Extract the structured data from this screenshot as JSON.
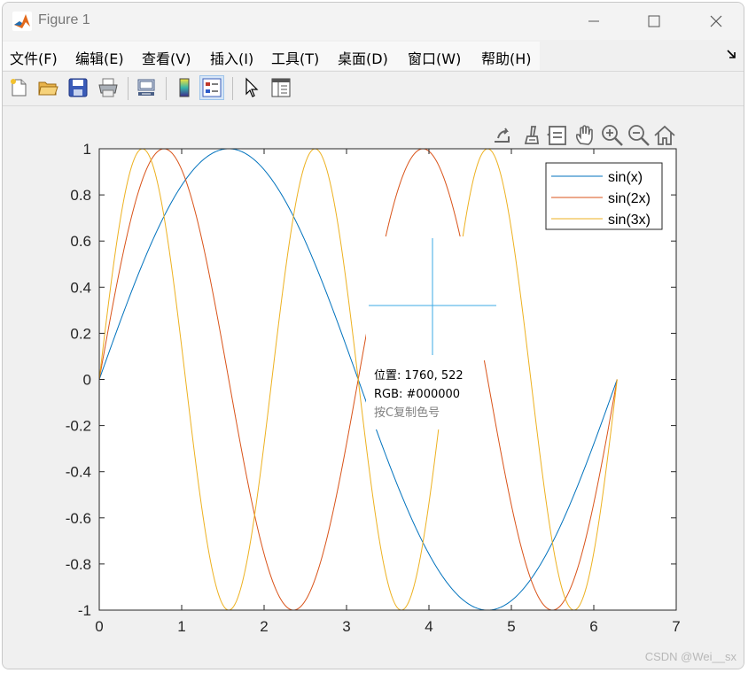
{
  "window": {
    "title": "Figure 1"
  },
  "menu": [
    {
      "label": "文件(F)"
    },
    {
      "label": "编辑(E)"
    },
    {
      "label": "查看(V)"
    },
    {
      "label": "插入(I)"
    },
    {
      "label": "工具(T)"
    },
    {
      "label": "桌面(D)"
    },
    {
      "label": "窗口(W)"
    },
    {
      "label": "帮助(H)"
    }
  ],
  "toolbar": {
    "icons": [
      "new-figure-icon",
      "open-file-icon",
      "save-icon",
      "print-icon",
      "link-plot-icon",
      "colorbar-icon",
      "legend-icon",
      "edit-plot-icon",
      "property-inspector-icon"
    ]
  },
  "axes_toolbar": {
    "icons": [
      "export-icon",
      "brush-icon",
      "datatip-icon",
      "pan-icon",
      "zoom-in-icon",
      "zoom-out-icon",
      "home-icon"
    ]
  },
  "chart_data": {
    "type": "line",
    "title": "",
    "xlabel": "",
    "ylabel": "",
    "xlim": [
      0,
      7
    ],
    "ylim": [
      -1,
      1
    ],
    "xticks": [
      "0",
      "1",
      "2",
      "3",
      "4",
      "5",
      "6",
      "7"
    ],
    "yticks": [
      "-1",
      "-0.8",
      "-0.6",
      "-0.4",
      "-0.2",
      "0",
      "0.2",
      "0.4",
      "0.6",
      "0.8",
      "1"
    ],
    "x_domain": [
      0,
      6.2832
    ],
    "grid": false,
    "legend_position": "top-right",
    "series": [
      {
        "name": "sin(x)",
        "expression": "sin(x)",
        "color": "#0072BD"
      },
      {
        "name": "sin(2x)",
        "expression": "sin(2x)",
        "color": "#D95319"
      },
      {
        "name": "sin(3x)",
        "expression": "sin(3x)",
        "color": "#EDB120"
      }
    ]
  },
  "color_picker": {
    "position_label": "位置: 1760, 522",
    "rgb_label": "RGB: #000000",
    "hint": "按C复制色号",
    "crosshair_color": "#3BA9E6",
    "hint_color": "#808080"
  },
  "watermark": "CSDN @Wei__sx"
}
